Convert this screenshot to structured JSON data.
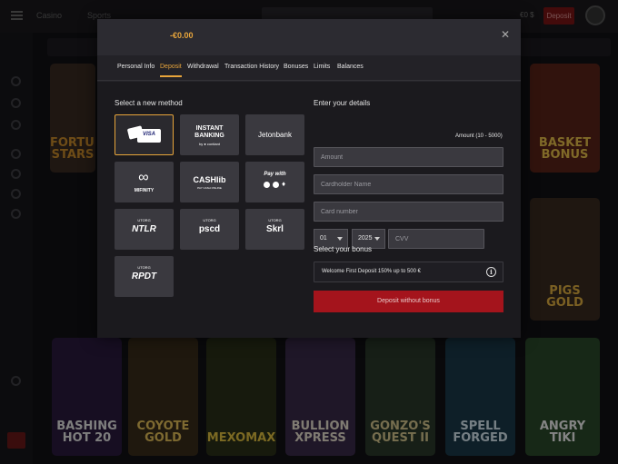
{
  "background": {
    "nav": [
      "Casino",
      "Sports"
    ],
    "balance": "€0 $",
    "deposit_label": "Deposit",
    "tiles": [
      {
        "text": "FORTUNE\nSTARS",
        "color": "#c98a2a"
      },
      {
        "text": "BASKET\nBONUS",
        "color": "#e8c04a"
      },
      {
        "text": "PIGS\nGOLD",
        "color": "#e0b040"
      },
      {
        "text": "BASHING\nHOT 20",
        "color": "#e6e6e6"
      },
      {
        "text": "COYOTE\nGOLD",
        "color": "#e6c15a"
      },
      {
        "text": "MEXOMAX",
        "color": "#e0c040"
      },
      {
        "text": "BULLION\nXPRESS",
        "color": "#e8e0d0"
      },
      {
        "text": "GONZO'S\nQUEST II",
        "color": "#d8c890"
      },
      {
        "text": "SPELL\nFORGED",
        "color": "#d8e8f0"
      },
      {
        "text": "ANGRY\nTIKI",
        "color": "#f0f0f0"
      }
    ]
  },
  "modal": {
    "amount": "-€0.00",
    "close_icon": "close-icon",
    "tabs": [
      {
        "label": "Personal Info",
        "active": false
      },
      {
        "label": "Deposit",
        "active": true
      },
      {
        "label": "Withdrawal",
        "active": false
      },
      {
        "label": "Transaction History",
        "active": false
      },
      {
        "label": "Bonuses",
        "active": false
      },
      {
        "label": "Limits",
        "active": false
      },
      {
        "label": "Balances",
        "active": false
      }
    ],
    "methods_title": "Select a new method",
    "methods": [
      {
        "id": "visa",
        "label": "VISA",
        "selected": true
      },
      {
        "id": "instant-banking",
        "label": "INSTANT\nBANKING",
        "sub": "by ● contiant",
        "selected": false
      },
      {
        "id": "jetonbank",
        "label": "Jetonbank",
        "selected": false
      },
      {
        "id": "mifinity",
        "label": "MIFINITY",
        "selected": false
      },
      {
        "id": "cashlib",
        "label": "CASHlib",
        "sub": "PAY CASH ONLINE",
        "selected": false
      },
      {
        "id": "pay-with-crypto",
        "label": "Pay with",
        "selected": false
      },
      {
        "id": "ntlr",
        "label": "NTLR",
        "sub": "UTORG",
        "selected": false
      },
      {
        "id": "pscd",
        "label": "pscd",
        "sub": "UTORG",
        "selected": false
      },
      {
        "id": "skrl",
        "label": "Skrl",
        "sub": "UTORG",
        "selected": false
      },
      {
        "id": "rpdt",
        "label": "RPDT",
        "sub": "UTORG",
        "selected": false
      }
    ],
    "details_title": "Enter your details",
    "amount_range": "Amount (10 - 5000)",
    "fields": {
      "amount_placeholder": "Amount",
      "cardholder_placeholder": "Cardholder Name",
      "card_number_placeholder": "Card number",
      "month": "01",
      "year": "2025",
      "cvv_placeholder": "CVV"
    },
    "bonus_title": "Select your bonus",
    "bonus_option": "Welcome First Deposit 150% up to 500 €",
    "deposit_button": "Deposit without bonus",
    "colors": {
      "accent": "#e8a53b",
      "primary_button": "#a4141c"
    }
  }
}
